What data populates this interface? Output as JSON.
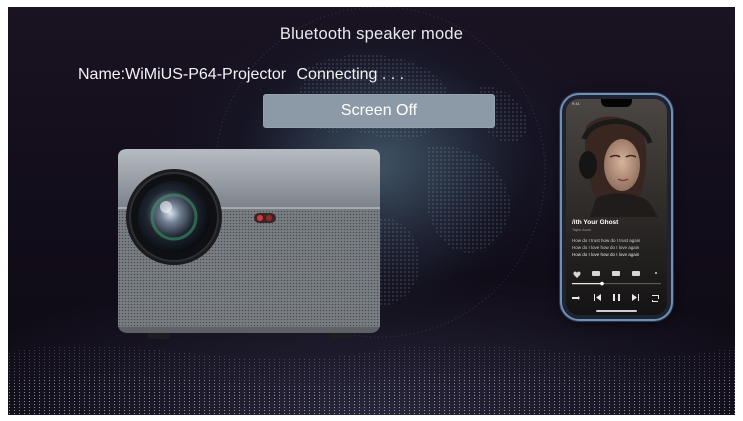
{
  "screen": {
    "mode_title": "Bluetooth speaker mode",
    "device_name_label": "Name:WiMiUS-P64-Projector",
    "connection_status": "Connecting . . .",
    "screen_off_label": "Screen Off"
  },
  "phone": {
    "status_time": "9:41",
    "song_title": "/ith Your Ghost",
    "song_artist": "Taylor Acorn",
    "lyrics": [
      "How do I trust how do I trust again",
      "How do I love how do I love again",
      "How do I love how do I love again"
    ]
  },
  "colors": {
    "button_bg": "#8c9aa7",
    "phone_frame": "#6f8fb4",
    "background": "#120d1a"
  },
  "icons": [
    "projector-illustration",
    "phone-illustration",
    "heart-icon",
    "play-pause-icon",
    "previous-icon",
    "next-icon",
    "shuffle-icon",
    "repeat-icon"
  ]
}
